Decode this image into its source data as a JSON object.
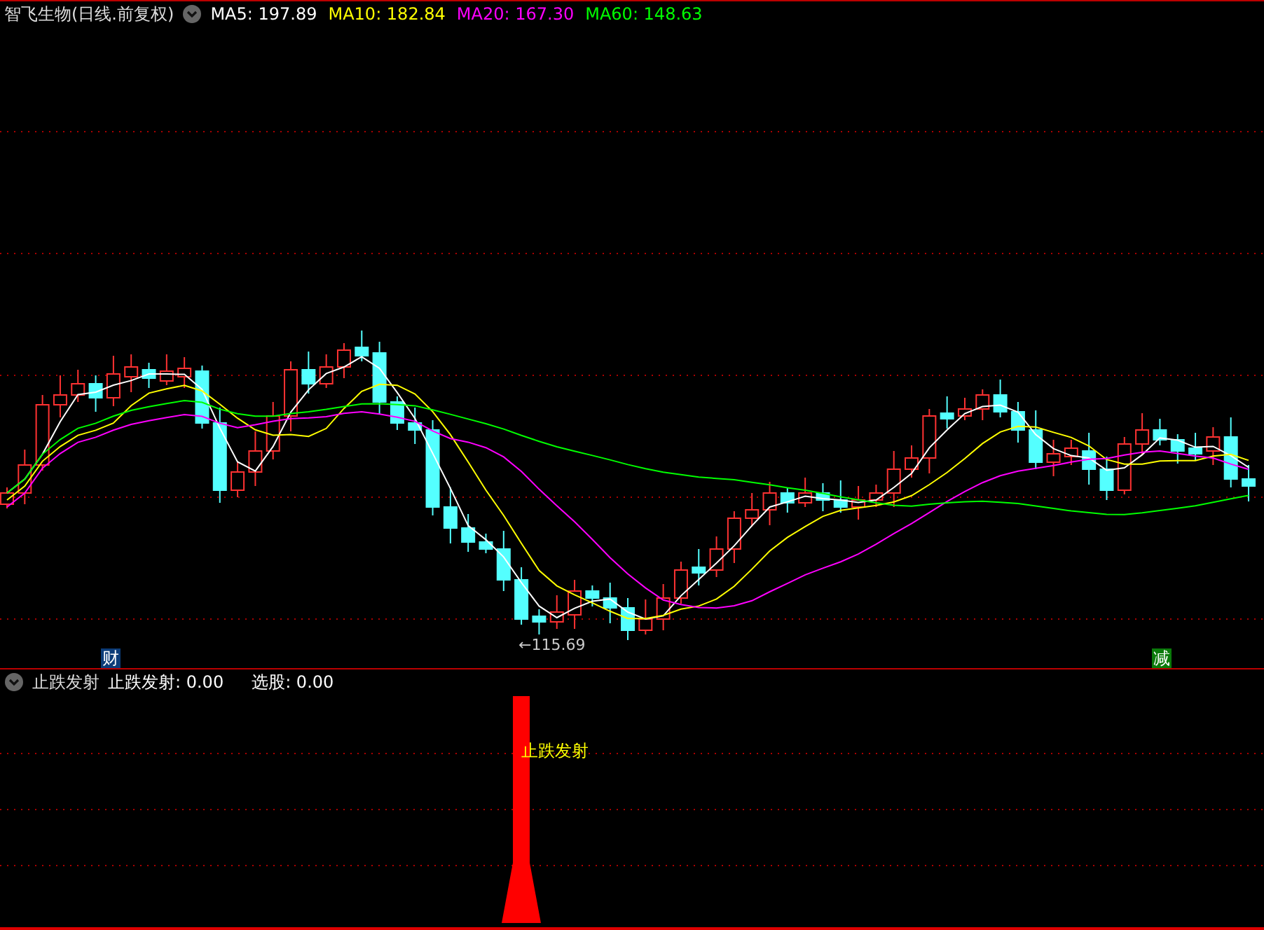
{
  "main_chart": {
    "title": "智飞生物(日线.前复权)",
    "indicators": [
      {
        "label": "MA5: 197.89",
        "color": "#ffffff"
      },
      {
        "label": "MA10: 182.84",
        "color": "#ffff00"
      },
      {
        "label": "MA20: 167.30",
        "color": "#ff00ff"
      },
      {
        "label": "MA60: 148.63",
        "color": "#00ff00"
      }
    ],
    "low_marker": "←115.69",
    "events": [
      {
        "label": "财",
        "color": "#0c3c78"
      },
      {
        "label": "减",
        "color": "#0a7a0a"
      }
    ]
  },
  "sub_chart": {
    "name": "止跌发射",
    "values": [
      {
        "label": "止跌发射: 0.00"
      },
      {
        "label": "选股: 0.00"
      }
    ],
    "signal_label": "止跌发射"
  }
}
